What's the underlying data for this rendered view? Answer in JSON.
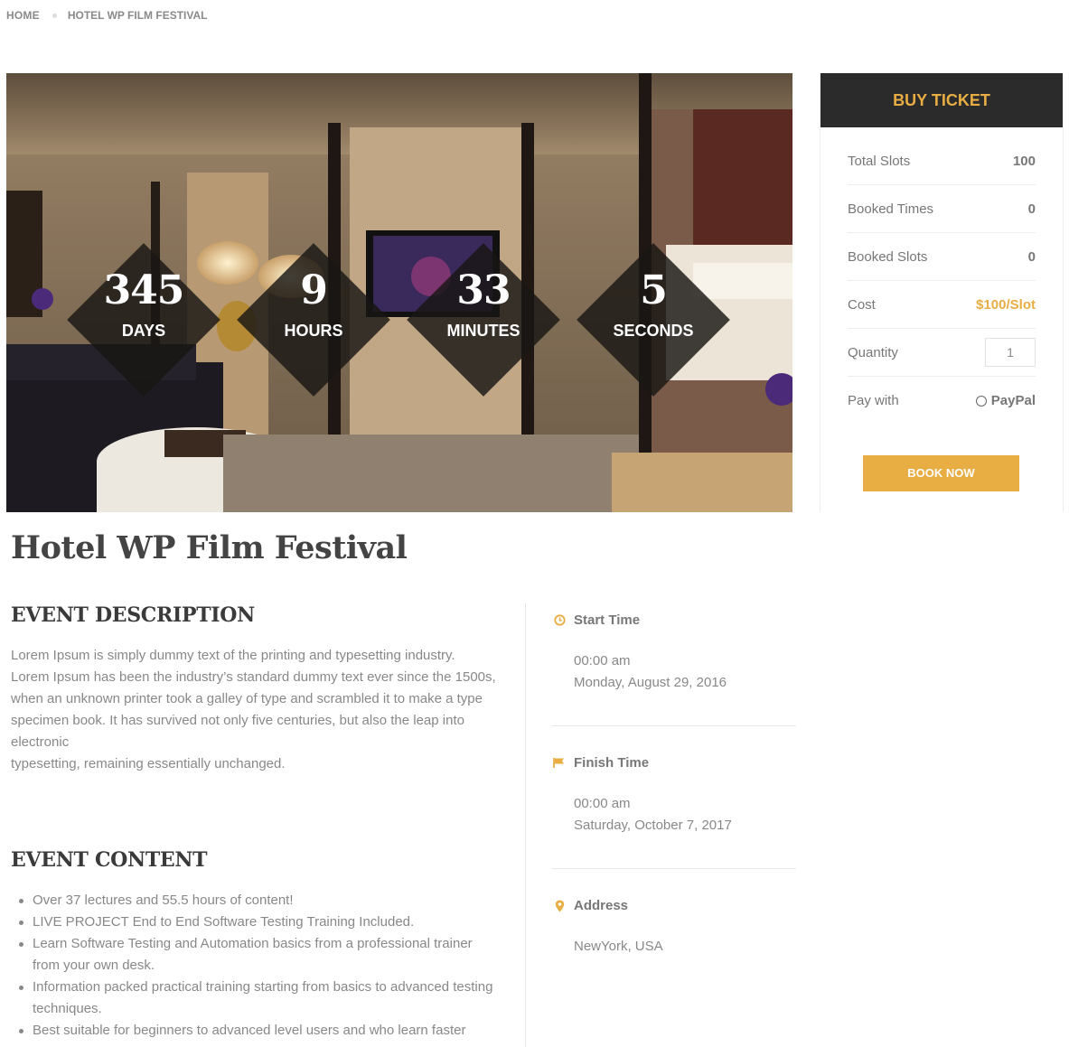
{
  "breadcrumb": {
    "home": "HOME",
    "current": "HOTEL WP FILM FESTIVAL"
  },
  "countdown": {
    "days": {
      "value": "345",
      "label": "DAYS"
    },
    "hours": {
      "value": "9",
      "label": "HOURS"
    },
    "minutes": {
      "value": "33",
      "label": "MINUTES"
    },
    "seconds": {
      "value": "5",
      "label": "SECONDS"
    }
  },
  "ticket": {
    "title": "BUY TICKET",
    "total_slots_label": "Total Slots",
    "total_slots": "100",
    "booked_times_label": "Booked Times",
    "booked_times": "0",
    "booked_slots_label": "Booked Slots",
    "booked_slots": "0",
    "cost_label": "Cost",
    "cost": "$100/Slot",
    "quantity_label": "Quantity",
    "quantity": "1",
    "pay_label": "Pay with",
    "pay_option": "PayPal",
    "book_label": "BOOK NOW"
  },
  "event": {
    "title": "Hotel WP Film Festival",
    "description_heading": "EVENT DESCRIPTION",
    "description_lines": [
      "Lorem Ipsum is simply dummy text of the printing and typesetting industry.",
      "Lorem Ipsum has been the industry’s standard dummy text ever since the 1500s,",
      "when an unknown printer took a galley of type and scrambled it to make a type",
      "specimen book. It has survived not only five centuries, but also the leap into",
      "electronic",
      "typesetting, remaining essentially unchanged."
    ],
    "content_heading": "EVENT CONTENT",
    "content_items": [
      "Over 37 lectures and 55.5 hours of content!",
      "LIVE PROJECT End to End Software Testing Training Included.",
      "Learn Software Testing and Automation basics from a professional trainer from your own desk.",
      "Information packed practical training starting from basics to advanced testing techniques.",
      "Best suitable for beginners to advanced level users and who learn faster"
    ]
  },
  "info": {
    "start_label": "Start Time",
    "start_time": "00:00 am",
    "start_date": "Monday, August 29, 2016",
    "finish_label": "Finish Time",
    "finish_time": "00:00 am",
    "finish_date": "Saturday, October 7, 2017",
    "address_label": "Address",
    "address": "NewYork, USA"
  },
  "colors": {
    "accent": "#e8ad43",
    "dark": "#2b2b2b",
    "text": "#777777"
  }
}
